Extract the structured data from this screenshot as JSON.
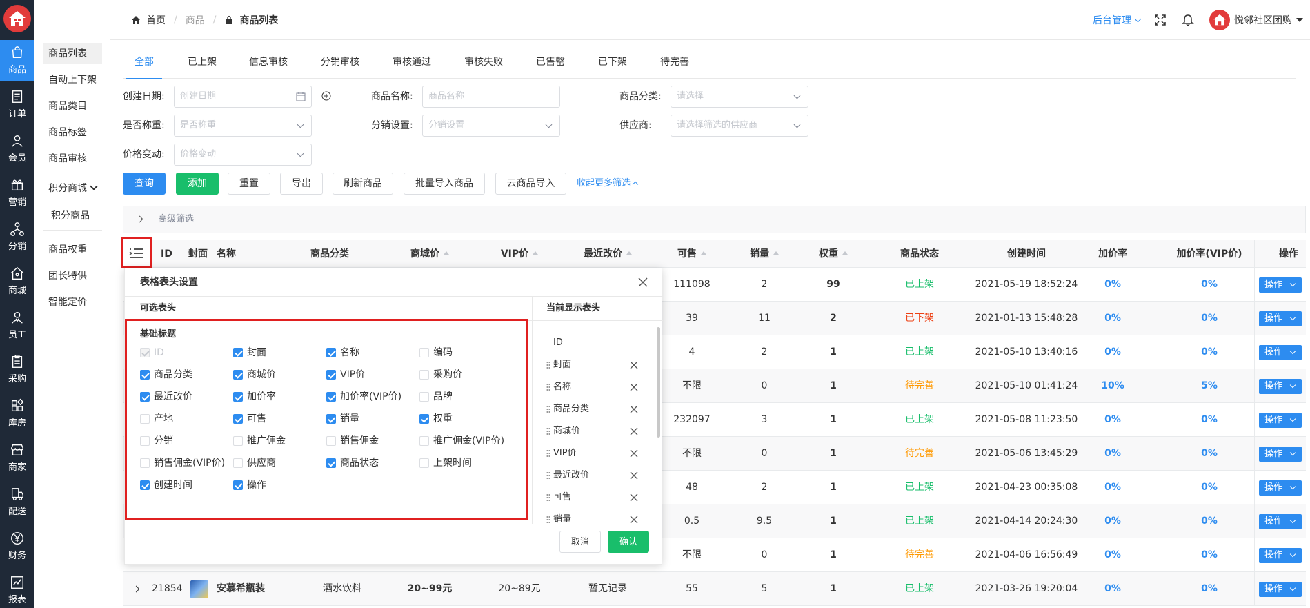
{
  "nav": [
    {
      "label": "商品",
      "icon": "bag-icon"
    },
    {
      "label": "订单",
      "icon": "order-icon"
    },
    {
      "label": "会员",
      "icon": "user-icon"
    },
    {
      "label": "营销",
      "icon": "gift-icon"
    },
    {
      "label": "分销",
      "icon": "share-icon"
    },
    {
      "label": "商城",
      "icon": "home-icon"
    },
    {
      "label": "员工",
      "icon": "staff-icon"
    },
    {
      "label": "采购",
      "icon": "clipboard-icon"
    },
    {
      "label": "库房",
      "icon": "grid-icon"
    },
    {
      "label": "商家",
      "icon": "store-icon"
    },
    {
      "label": "配送",
      "icon": "delivery-icon"
    },
    {
      "label": "财务",
      "icon": "yen-icon"
    },
    {
      "label": "报表",
      "icon": "chart-icon"
    }
  ],
  "subnav": [
    "商品列表",
    "自动上下架",
    "商品类目",
    "商品标签",
    "商品审核",
    "积分商城",
    "积分商品",
    "商品权重",
    "团长特供",
    "智能定价"
  ],
  "breadcrumb": {
    "home": "首页",
    "mid": "商品",
    "current": "商品列表"
  },
  "header": {
    "admin": "后台管理",
    "brand": "悦邻社区团购"
  },
  "tabs": [
    "全部",
    "已上架",
    "信息审核",
    "分销审核",
    "审核通过",
    "审核失败",
    "已售罄",
    "已下架",
    "待完善"
  ],
  "filters": {
    "create_date_label": "创建日期:",
    "create_date_ph": "创建日期",
    "name_label": "商品名称:",
    "name_ph": "商品名称",
    "category_label": "商品分类:",
    "category_ph": "请选择",
    "weigh_label": "是否称重:",
    "weigh_ph": "是否称重",
    "dist_label": "分销设置:",
    "dist_ph": "分销设置",
    "supplier_label": "供应商:",
    "supplier_ph": "请选择筛选的供应商",
    "price_label": "价格变动:",
    "price_ph": "价格变动"
  },
  "buttons": [
    "查询",
    "添加",
    "重置",
    "导出",
    "刷新商品",
    "批量导入商品",
    "云商品导入"
  ],
  "more_filters": "收起更多筛选",
  "advanced": "高级筛选",
  "columns": [
    "ID",
    "封面",
    "名称",
    "商品分类",
    "商城价",
    "VIP价",
    "最近改价",
    "可售",
    "销量",
    "权重",
    "商品状态",
    "创建时间",
    "加价率",
    "加价率(VIP价)",
    "操作"
  ],
  "status_colors": {
    "已上架": "#19be6b",
    "已下架": "#ed4014",
    "待完善": "#ff9900"
  },
  "rows": [
    {
      "stock": "111098",
      "sales": "2",
      "weight": "99",
      "status": "已上架",
      "created": "2021-05-19 18:52:24",
      "rate": "0%",
      "rate_vip": "0%"
    },
    {
      "stock": "39",
      "sales": "11",
      "weight": "2",
      "status": "已下架",
      "created": "2021-01-13 15:48:28",
      "rate": "0%",
      "rate_vip": "0%"
    },
    {
      "stock": "4",
      "sales": "2",
      "weight": "1",
      "status": "已上架",
      "created": "2021-05-10 13:40:16",
      "rate": "0%",
      "rate_vip": "0%"
    },
    {
      "stock": "不限",
      "sales": "0",
      "weight": "1",
      "status": "待完善",
      "created": "2021-05-10 01:41:24",
      "rate": "10%",
      "rate_vip": "5%"
    },
    {
      "stock": "232097",
      "sales": "3",
      "weight": "1",
      "status": "已上架",
      "created": "2021-05-08 11:23:50",
      "rate": "0%",
      "rate_vip": "0%"
    },
    {
      "stock": "不限",
      "sales": "0",
      "weight": "1",
      "status": "待完善",
      "created": "2021-05-06 13:45:29",
      "rate": "0%",
      "rate_vip": "0%"
    },
    {
      "stock": "48",
      "sales": "2",
      "weight": "1",
      "status": "已上架",
      "created": "2021-04-23 00:35:08",
      "rate": "0%",
      "rate_vip": "0%"
    },
    {
      "stock": "0.5",
      "sales": "9.5",
      "weight": "1",
      "status": "已上架",
      "created": "2021-04-14 20:24:30",
      "rate": "0%",
      "rate_vip": "0%"
    },
    {
      "stock": "不限",
      "sales": "0",
      "weight": "1",
      "status": "待完善",
      "created": "2021-04-06 16:56:49",
      "rate": "0%",
      "rate_vip": "0%"
    }
  ],
  "last_row": {
    "id": "21854",
    "name": "安慕希瓶装",
    "category": "酒水饮料",
    "price": "20~99元",
    "vip": "20~89元",
    "last_change": "暂无记录",
    "stock": "55",
    "sales": "5",
    "weight": "1",
    "status": "已上架",
    "created": "2021-03-26 19:20:04",
    "rate": "0%",
    "rate_vip": "0%"
  },
  "op_label": "操作",
  "modal": {
    "title": "表格表头设置",
    "available": "可选表头",
    "current": "当前显示表头",
    "group": "基础标题",
    "options": [
      {
        "label": "ID",
        "checked": true,
        "disabled": true
      },
      {
        "label": "封面",
        "checked": true
      },
      {
        "label": "名称",
        "checked": true
      },
      {
        "label": "编码",
        "checked": false
      },
      {
        "label": "商品分类",
        "checked": true
      },
      {
        "label": "商城价",
        "checked": true
      },
      {
        "label": "VIP价",
        "checked": true
      },
      {
        "label": "采购价",
        "checked": false
      },
      {
        "label": "最近改价",
        "checked": true
      },
      {
        "label": "加价率",
        "checked": true
      },
      {
        "label": "加价率(VIP价)",
        "checked": true
      },
      {
        "label": "品牌",
        "checked": false
      },
      {
        "label": "产地",
        "checked": false
      },
      {
        "label": "可售",
        "checked": true
      },
      {
        "label": "销量",
        "checked": true
      },
      {
        "label": "权重",
        "checked": true
      },
      {
        "label": "分销",
        "checked": false
      },
      {
        "label": "推广佣金",
        "checked": false
      },
      {
        "label": "销售佣金",
        "checked": false
      },
      {
        "label": "推广佣金(VIP价)",
        "checked": false
      },
      {
        "label": "销售佣金(VIP价)",
        "checked": false
      },
      {
        "label": "供应商",
        "checked": false
      },
      {
        "label": "商品状态",
        "checked": true
      },
      {
        "label": "上架时间",
        "checked": false
      },
      {
        "label": "创建时间",
        "checked": true
      },
      {
        "label": "操作",
        "checked": true
      }
    ],
    "current_list": [
      "ID",
      "封面",
      "名称",
      "商品分类",
      "商城价",
      "VIP价",
      "最近改价",
      "可售",
      "销量"
    ],
    "cancel": "取消",
    "confirm": "确认"
  }
}
